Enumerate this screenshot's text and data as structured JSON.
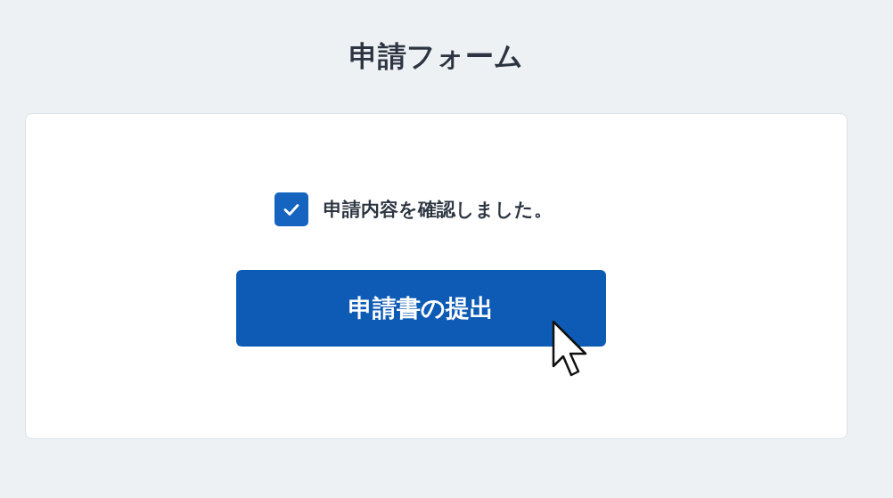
{
  "title": "申請フォーム",
  "confirmation": {
    "label": "申請内容を確認しました。",
    "checked": true
  },
  "submit_button": {
    "label": "申請書の提出"
  }
}
